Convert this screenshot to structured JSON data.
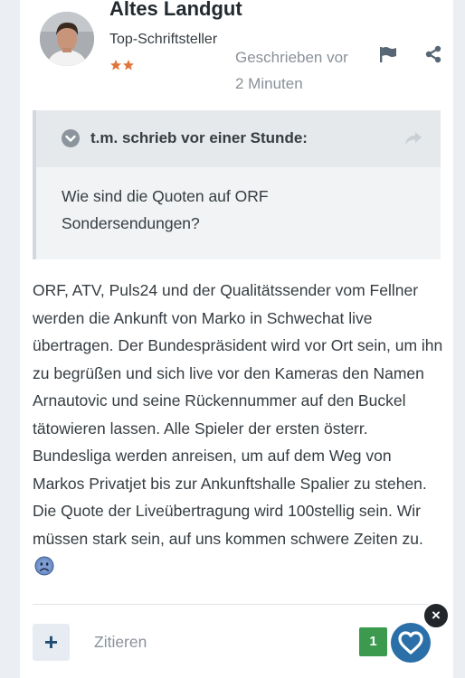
{
  "author": {
    "name": "Altes Landgut",
    "rank": "Top-Schriftsteller",
    "rank_stars": 2
  },
  "post": {
    "timestamp": "Geschrieben vor 2 Minuten",
    "quote": {
      "citation": "t.m. schrieb vor einer Stunde:",
      "text": "Wie sind die Quoten auf ORF Sondersendungen?"
    },
    "body": "ORF, ATV, Puls24 und der Qualitätssender vom Fellner werden die Ankunft von Marko in Schwechat live übertragen. Der Bundespräsident wird vor Ort sein, um ihn zu begrüßen und sich live vor den Kameras den Namen Arnautovic und seine Rückennummer auf den Buckel tätowieren lassen. Alle Spieler der ersten österr. Bundesliga werden anreisen, um auf dem Weg von Markos Privatjet bis zur Ankunftshalle Spalier zu stehen. Die Quote der Liveübertragung wird 100stellig sein. Wir müssen stark sein, auf uns kommen schwere Zeiten zu.",
    "emoji": "sad-face-icon"
  },
  "actions": {
    "multiquote_label": "+",
    "quote_label": "Zitieren",
    "reaction_count": "1",
    "close_label": "×"
  },
  "colors": {
    "accent": "#2a6fa8",
    "reaction_badge": "#3b9a4e",
    "stars": "#e0743a",
    "muted_text": "#8a9199"
  },
  "icons": {
    "report": "flag-icon",
    "share": "share-icon",
    "quote_toggle": "chevron-down-circle-icon",
    "quote_goto": "reply-arrow-icon",
    "react": "heart-icon"
  }
}
